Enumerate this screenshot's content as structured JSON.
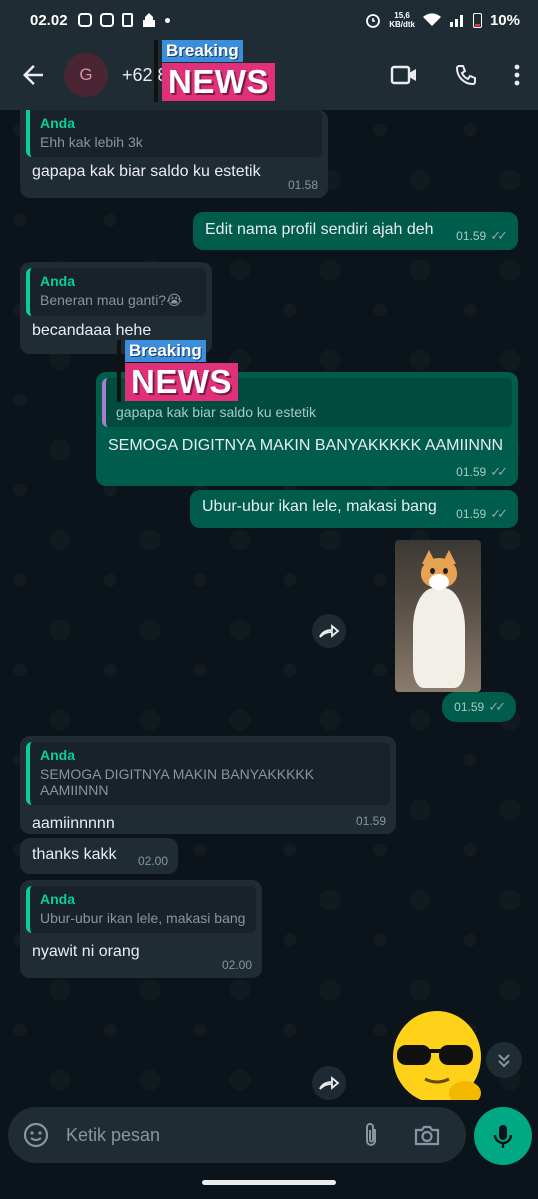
{
  "status_bar": {
    "time": "02.02",
    "network_speed_value": "15,6",
    "network_speed_unit": "KB/dtk",
    "battery": "10%"
  },
  "header": {
    "avatar_letter": "G",
    "contact_name": "+62 8",
    "icons": [
      "back-arrow-icon",
      "video-call-icon",
      "voice-call-icon",
      "more-options-icon"
    ]
  },
  "stickers": {
    "breaking": "Breaking",
    "news": "NEWS"
  },
  "messages": [
    {
      "direction": "in",
      "quote_name": "Anda",
      "quote_text": "Ehh kak lebih 3k",
      "text": "gapapa kak biar saldo ku estetik",
      "time": "01.58"
    },
    {
      "direction": "out",
      "text": "Edit nama profil sendiri ajah deh",
      "time": "01.59"
    },
    {
      "direction": "in",
      "quote_name": "Anda",
      "quote_text": "Beneran mau ganti?😭",
      "text": "becandaaa hehe",
      "time": "01.59"
    },
    {
      "direction": "out",
      "quote_name": "",
      "quote_text": "gapapa kak biar saldo ku estetik",
      "text": "SEMOGA DIGITNYA MAKIN BANYAKKKKK AAMIINNN",
      "time": "01.59"
    },
    {
      "direction": "out",
      "text": "Ubur-ubur ikan lele, makasi bang",
      "time": "01.59"
    },
    {
      "direction": "out",
      "type": "image",
      "time": "01.59"
    },
    {
      "direction": "in",
      "quote_name": "Anda",
      "quote_text": "SEMOGA DIGITNYA MAKIN BANYAKKKKK AAMIINNN",
      "text": "aamiinnnnn",
      "time": "01.59"
    },
    {
      "direction": "in",
      "text": "thanks kakk",
      "time": "02.00"
    },
    {
      "direction": "in",
      "quote_name": "Anda",
      "quote_text": "Ubur-ubur ikan lele, makasi bang",
      "text": "nyawit ni orang",
      "time": "02.00"
    }
  ],
  "input": {
    "placeholder": "Ketik pesan"
  },
  "colors": {
    "incoming_bubble": "#1f2c34",
    "outgoing_bubble": "#005c4b",
    "accent_green": "#00a884",
    "quote_name": "#06cf9c"
  }
}
